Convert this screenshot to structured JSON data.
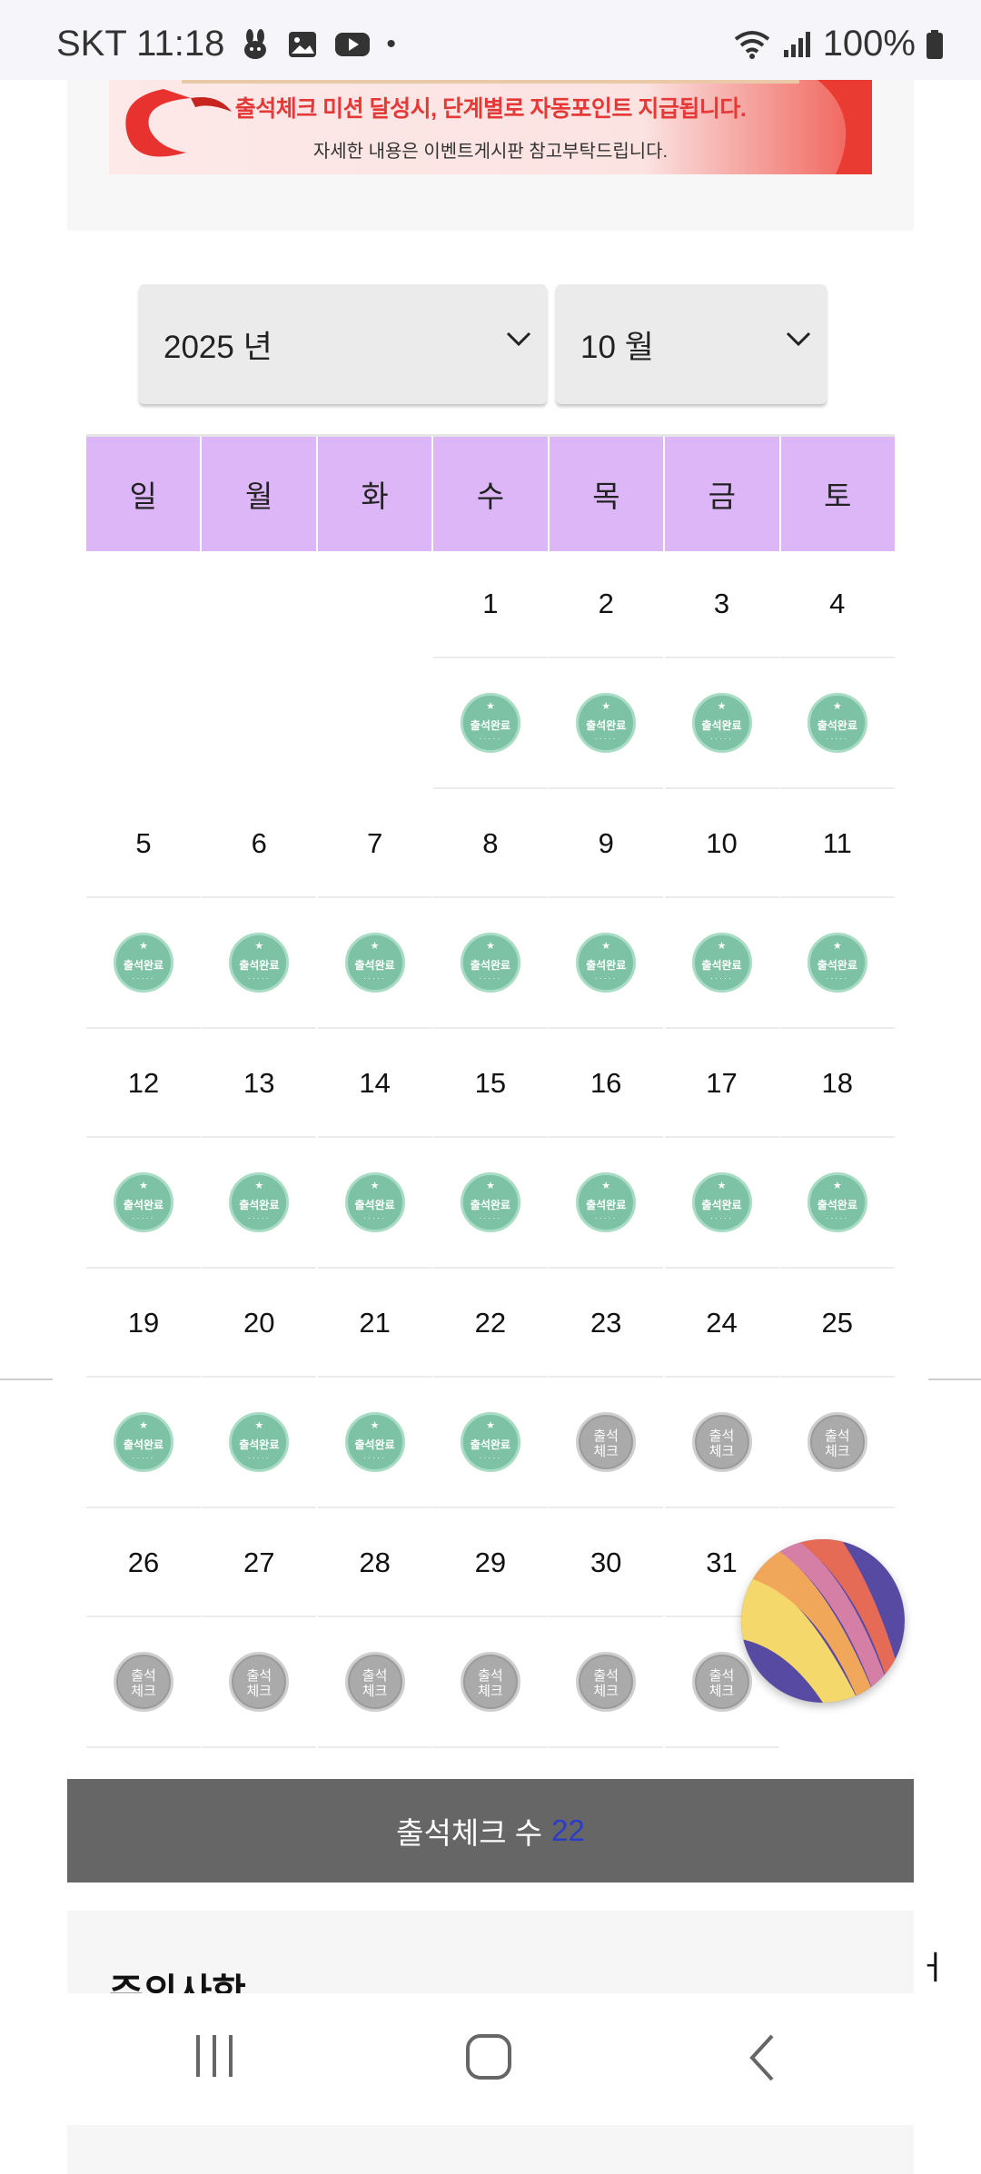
{
  "status_bar": {
    "carrier_time": "SKT 11:18",
    "dot": "•",
    "battery": "100%"
  },
  "banner": {
    "line1": "출석체크 미션 달성시, 단계별로 자동포인트 지급됩니다.",
    "line2": "자세한 내용은 이벤트게시판 참고부탁드립니다."
  },
  "selects": {
    "year": "2025 년",
    "month": "10 월"
  },
  "weekdays": [
    "일",
    "월",
    "화",
    "수",
    "목",
    "금",
    "토"
  ],
  "weeks": [
    [
      {
        "day": ""
      },
      {
        "day": ""
      },
      {
        "day": ""
      },
      {
        "day": "1"
      },
      {
        "day": "2"
      },
      {
        "day": "3"
      },
      {
        "day": "4"
      }
    ],
    [
      {
        "day": "5"
      },
      {
        "day": "6"
      },
      {
        "day": "7"
      },
      {
        "day": "8"
      },
      {
        "day": "9"
      },
      {
        "day": "10"
      },
      {
        "day": "11"
      }
    ],
    [
      {
        "day": "12"
      },
      {
        "day": "13"
      },
      {
        "day": "14"
      },
      {
        "day": "15"
      },
      {
        "day": "16"
      },
      {
        "day": "17"
      },
      {
        "day": "18"
      }
    ],
    [
      {
        "day": "19"
      },
      {
        "day": "20"
      },
      {
        "day": "21"
      },
      {
        "day": "22"
      },
      {
        "day": "23"
      },
      {
        "day": "24"
      },
      {
        "day": "25"
      }
    ],
    [
      {
        "day": "26"
      },
      {
        "day": "27"
      },
      {
        "day": "28"
      },
      {
        "day": "29"
      },
      {
        "day": "30"
      },
      {
        "day": "31"
      },
      {
        "day": ""
      }
    ]
  ],
  "stamps": [
    [
      "none",
      "none",
      "none",
      "done",
      "done",
      "done",
      "done"
    ],
    [
      "done",
      "done",
      "done",
      "done",
      "done",
      "done",
      "done"
    ],
    [
      "done",
      "done",
      "done",
      "done",
      "done",
      "done",
      "done"
    ],
    [
      "done",
      "done",
      "done",
      "done",
      "todo",
      "todo",
      "todo"
    ],
    [
      "todo",
      "todo",
      "todo",
      "todo",
      "todo",
      "todo",
      "none"
    ]
  ],
  "stamp_labels": {
    "done": "출석완료",
    "todo_line1": "출석",
    "todo_line2": "체크"
  },
  "count_bar": {
    "label": "출석체크 수",
    "value": "22"
  },
  "notice": {
    "title": "주의사항"
  },
  "side_char": "ㅓ",
  "colors": {
    "weekday_header": "#ddb6f8",
    "stamp_done": "#7dc2a4",
    "stamp_todo": "#aaaaaa",
    "count_bar_bg": "#666666",
    "count_value": "#2a3cc8",
    "banner_text": "#e53937"
  },
  "icons": {
    "status": [
      "rabbit-icon",
      "gallery-icon",
      "youtube-icon",
      "wifi-icon",
      "signal-icon",
      "battery-icon"
    ],
    "nav": [
      "recent-apps-icon",
      "home-icon",
      "back-icon"
    ]
  }
}
